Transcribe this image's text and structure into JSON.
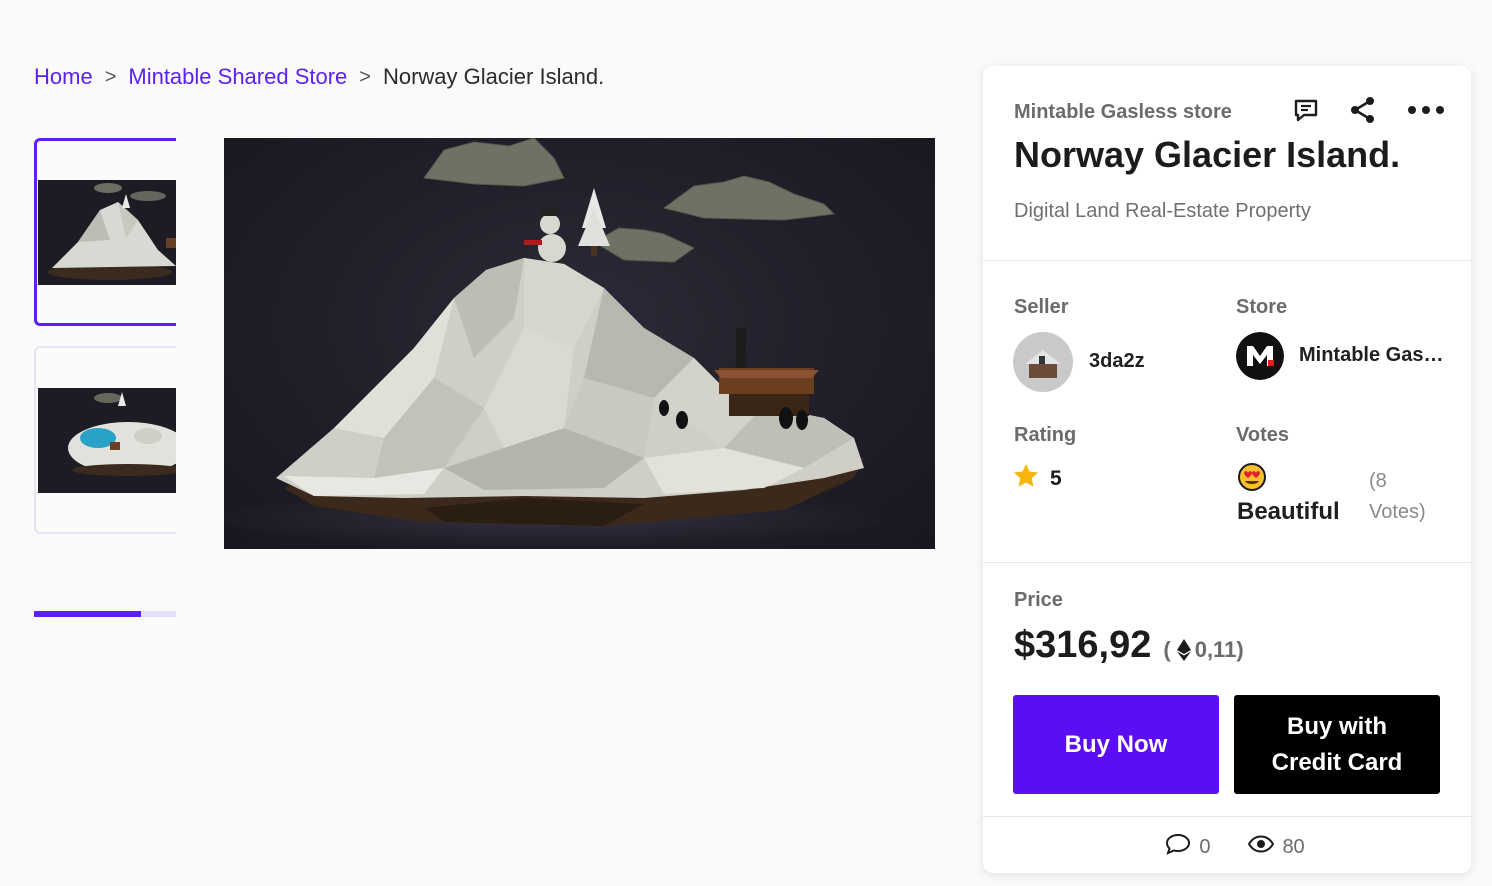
{
  "breadcrumb": {
    "home": "Home",
    "store": "Mintable Shared Store",
    "current": "Norway Glacier Island.",
    "separator": ">"
  },
  "thumbnails": {
    "count": 2,
    "active_index": 0,
    "scroll_progress": 0.75
  },
  "panel": {
    "store_name": "Mintable Gasless store",
    "icons": [
      "comment-icon",
      "share-icon",
      "more-icon"
    ],
    "title": "Norway Glacier Island.",
    "subtitle": "Digital Land Real-Estate Property",
    "seller_label": "Seller",
    "seller_name": "3da2z",
    "store_label": "Store",
    "store_link": "Mintable Gasless store",
    "rating_label": "Rating",
    "rating_value": "5",
    "votes_label": "Votes",
    "vote_word": "Beautiful",
    "vote_count": "(8 Votes)",
    "price_label": "Price",
    "price_usd": "$316,92",
    "price_eth_open": "(",
    "price_eth": "0,11",
    "price_eth_close": ")",
    "buy_now": "Buy Now",
    "buy_card": "Buy with Credit Card",
    "comments": "0",
    "views": "80"
  },
  "colors": {
    "accent": "#5b21f2",
    "buy_button": "#5b0ef2",
    "card_button": "#000000",
    "star": "#f5b50a"
  }
}
